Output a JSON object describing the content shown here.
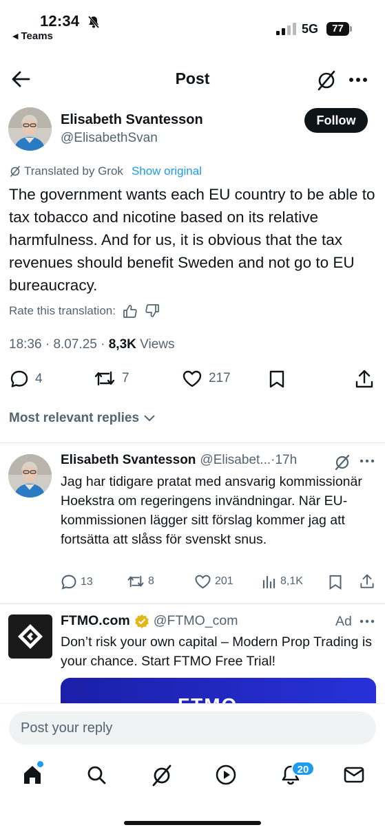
{
  "status_bar": {
    "time": "12:34",
    "back_app": "Teams",
    "network": "5G",
    "battery": "77"
  },
  "header": {
    "title": "Post"
  },
  "post": {
    "author_name": "Elisabeth Svantesson",
    "author_handle": "@ElisabethSvan",
    "follow_label": "Follow",
    "translated_label": "Translated by Grok",
    "show_original_label": "Show original",
    "body": "The government wants each EU country to be able to tax tobacco and nicotine based on its relative harmfulness. And for us, it is obvious that the tax revenues should benefit Sweden and not go to EU bureaucracy.",
    "rate_label": "Rate this translation:",
    "time": "18:36",
    "date": "8.07.25",
    "views_count": "8,3K",
    "views_label": "Views",
    "replies": "4",
    "reposts": "7",
    "likes": "217"
  },
  "replies_filter": {
    "label": "Most relevant replies"
  },
  "reply": {
    "author_name": "Elisabeth Svantesson",
    "author_handle": "@Elisabet...",
    "time": "17h",
    "body": "Jag har tidigare pratat med ansvarig kommissionär Hoekstra om regeringens invändningar. När EU-kommissionen lägger sitt förslag kommer jag att fortsätta att slåss för svenskt snus.",
    "replies": "13",
    "reposts": "8",
    "likes": "201",
    "views": "8,1K"
  },
  "ad": {
    "author_name": "FTMO.com",
    "author_handle": "@FTMO_com",
    "ad_label": "Ad",
    "body": "Don’t risk your own capital – Modern Prop Trading is your chance. Start FTMO Free Trial!",
    "card_brand": "FTMO"
  },
  "composer": {
    "placeholder": "Post your reply"
  },
  "tabbar": {
    "notifications_badge": "20"
  },
  "colors": {
    "accent": "#1d9bf0",
    "secondary_text": "#536471",
    "primary_text": "#0f1419",
    "verified_gold": "#e2b719"
  }
}
